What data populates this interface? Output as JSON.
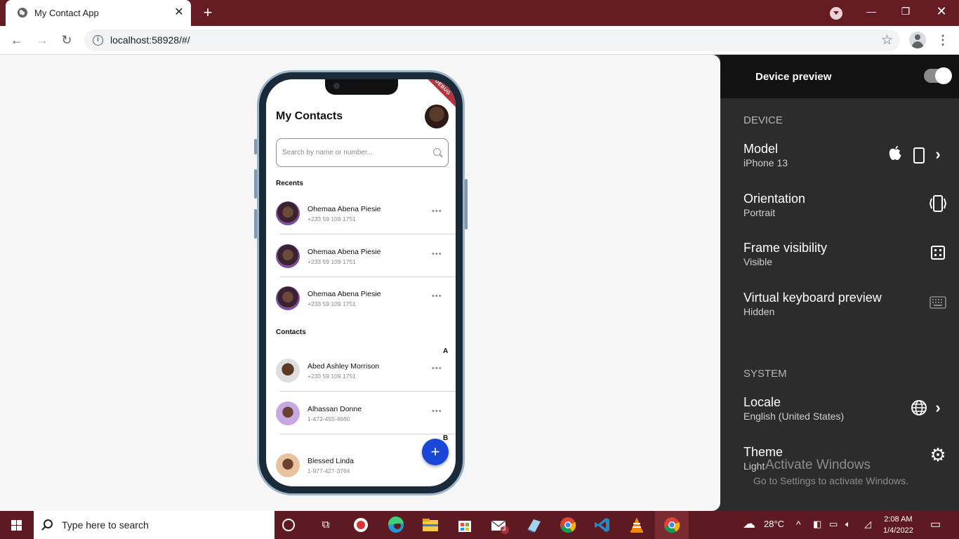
{
  "browser": {
    "tab_title": "My Contact App",
    "url": "localhost:58928/#/"
  },
  "phone": {
    "debug_banner": "DEBUG",
    "title": "My Contacts",
    "search_placeholder": "Search by name or number...",
    "recents_label": "Recents",
    "recents": [
      {
        "name": "Ohemaa Abena Piesie",
        "phone": "+233 59 109 1751"
      },
      {
        "name": "Ohemaa Abena Piesie",
        "phone": "+233 59 109 1751"
      },
      {
        "name": "Ohemaa Abena Piesie",
        "phone": "+233 59 109 1751"
      }
    ],
    "contacts_label": "Contacts",
    "index_letter_a": "A",
    "index_letter_b": "B",
    "contacts": [
      {
        "name": "Abed Ashley Morrison",
        "phone": "+233 59 109 1751"
      },
      {
        "name": "Alhassan Donne",
        "phone": "1-472-455-4660"
      },
      {
        "name": "Blessed Linda",
        "phone": "1-977-427-3764"
      }
    ],
    "more_glyph": "•••",
    "fab_glyph": "+"
  },
  "device_preview": {
    "title": "Device preview",
    "toggle_on": true,
    "device_section": "DEVICE",
    "model_label": "Model",
    "model_value": "iPhone 13",
    "orientation_label": "Orientation",
    "orientation_value": "Portrait",
    "frame_label": "Frame visibility",
    "frame_value": "Visible",
    "keyboard_label": "Virtual keyboard preview",
    "keyboard_value": "Hidden",
    "system_section": "SYSTEM",
    "locale_label": "Locale",
    "locale_value": "English (United States)",
    "theme_label": "Theme",
    "theme_value": "Light"
  },
  "watermark": {
    "line1": "Activate Windows",
    "line2": "Go to Settings to activate Windows."
  },
  "taskbar": {
    "search_text": "Type here to search",
    "mail_badge": "3",
    "temperature": "28°C",
    "time": "2:08 AM",
    "date": "1/4/2022"
  },
  "colors": {
    "titlebar": "#641b22",
    "fab": "#1a47d8",
    "panel": "#2c2c2c"
  }
}
